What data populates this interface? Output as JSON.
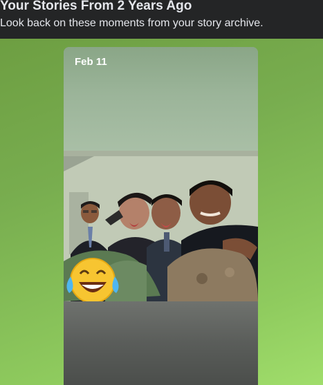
{
  "header": {
    "title": "Your Stories From 2 Years Ago",
    "subtitle": "Look back on these moments from your story archive."
  },
  "story": {
    "date": "Feb 11",
    "sticker": "laughing-crying-emoji",
    "photo_subject": "group-selfie-photo"
  },
  "colors": {
    "header_bg": "#242526",
    "page_bg_start": "#6b9b3f",
    "page_bg_end": "#a0dd6b",
    "text_light": "#e4e6eb"
  }
}
